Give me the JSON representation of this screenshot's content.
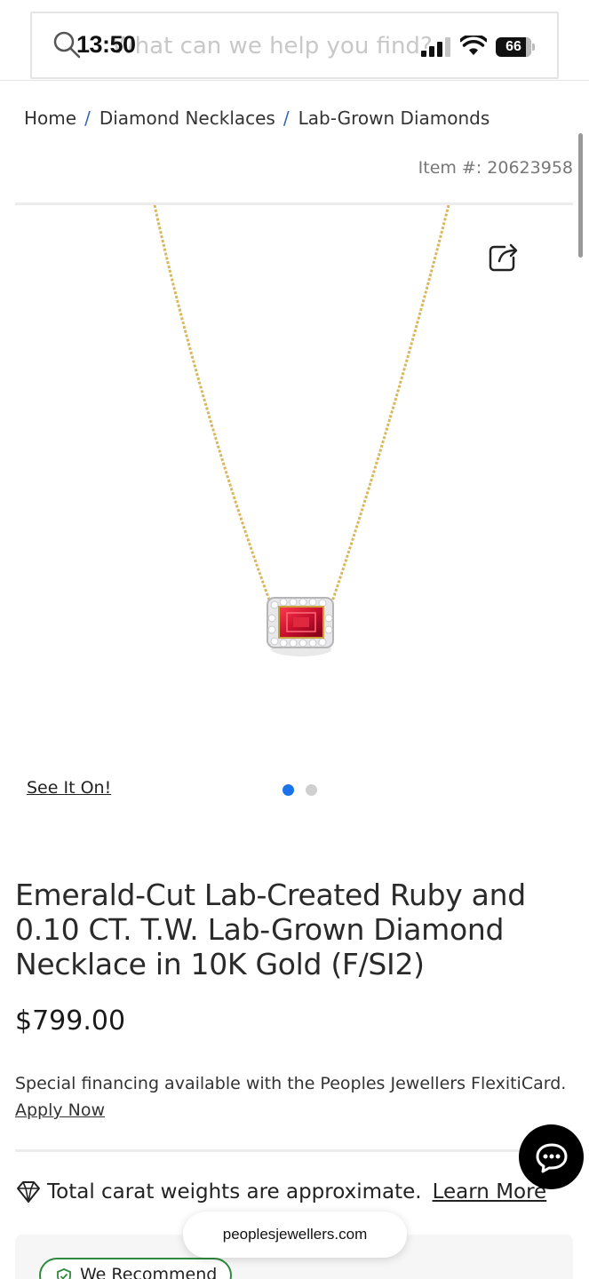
{
  "status_bar": {
    "time": "13:50",
    "battery": "66"
  },
  "search": {
    "placeholder": "What can we help you find?"
  },
  "breadcrumb": {
    "items": [
      "Home",
      "Diamond Necklaces",
      "Lab-Grown Diamonds"
    ],
    "separator": "/"
  },
  "product": {
    "item_number": "Item #: 20623958",
    "see_it_on": "See It On!",
    "gallery": {
      "image_count": 2,
      "active_index": 0
    },
    "title": "Emerald-Cut Lab-Created Ruby and 0.10 CT. T.W. Lab-Grown Diamond Necklace in 10K Gold (F/SI2)",
    "price": "$799.00",
    "financing_text": "Special financing available with the Peoples Jewellers FlexitiCard.",
    "apply_now": "Apply Now",
    "carat_note": "Total carat weights are approximate.",
    "learn_more": "Learn More",
    "recommend_badge": "We Recommend"
  },
  "browser": {
    "url": "peoplesjewellers.com"
  },
  "icons": {
    "search": "search-icon",
    "share": "share-icon",
    "diamond": "diamond-icon",
    "chat": "chat-icon"
  },
  "colors": {
    "accent_blue": "#1a73e8",
    "breadcrumb_separator": "#3a66b0",
    "badge_green": "#2e8b3e",
    "gold_chain": "#d9b75c",
    "ruby": "#c8102e"
  }
}
